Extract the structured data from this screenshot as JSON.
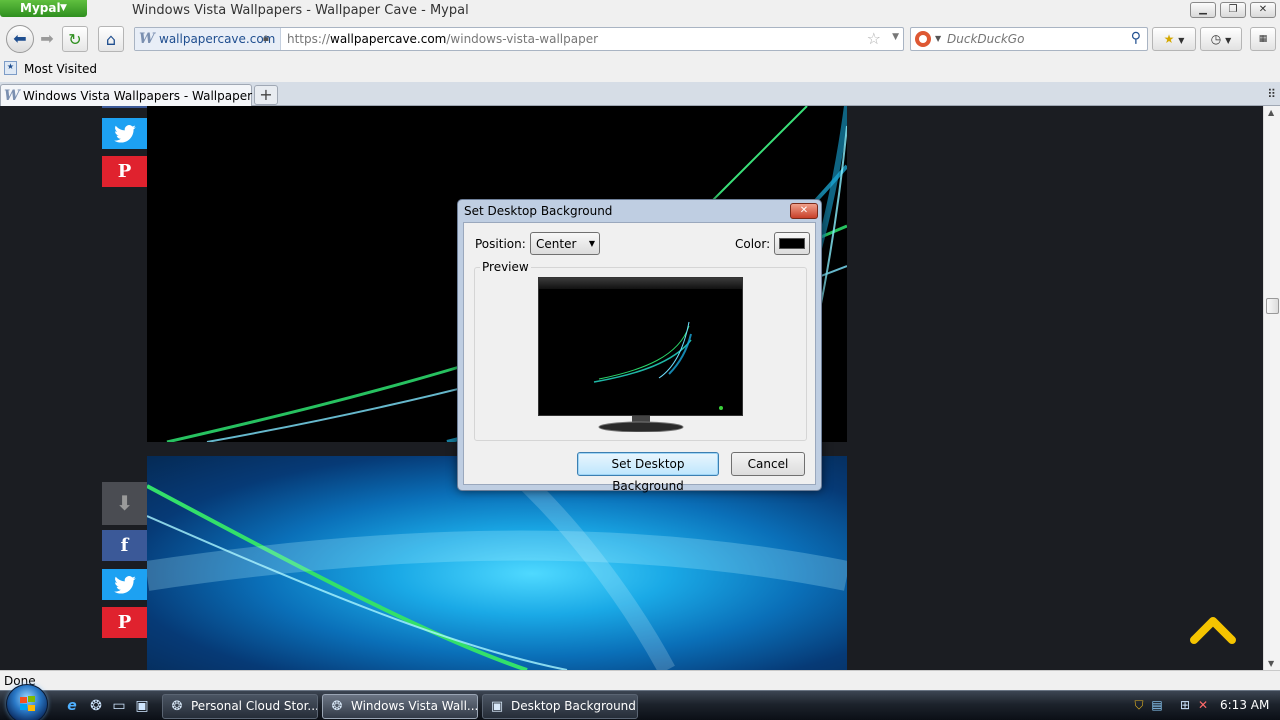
{
  "browser": {
    "app_menu_label": "Mypal",
    "window_title": "Windows Vista Wallpapers - Wallpaper Cave - Mypal",
    "site_domain": "wallpapercave.com",
    "url_scheme": "https://",
    "url_host": "wallpapercave.com",
    "url_path": "/windows-vista-wallpaper",
    "search_placeholder": "DuckDuckGo",
    "bookmark_most_visited": "Most Visited",
    "tab_title": "Windows Vista Wallpapers - Wallpaper C...",
    "status_text": "Done"
  },
  "dialog": {
    "title": "Set Desktop Background",
    "position_label": "Position:",
    "position_value": "Center",
    "color_label": "Color:",
    "color_value": "#000000",
    "preview_label": "Preview",
    "set_button_label": "Set Desktop Background",
    "cancel_button_label": "Cancel"
  },
  "taskbar": {
    "tasks": [
      {
        "label": "Personal Cloud Stor...",
        "icon": "browser-icon"
      },
      {
        "label": "Windows Vista Wall...",
        "icon": "browser-icon",
        "active": true
      },
      {
        "label": "Desktop Background",
        "icon": "display-icon"
      }
    ],
    "clock": "6:13 AM"
  },
  "colors": {
    "page_background": "#1b1d22",
    "facebook": "#3b5998",
    "twitter": "#1da1f2",
    "pinterest": "#e0222e",
    "scroll_top_arrow": "#f5c400",
    "dialog_frame": "#bfcee2"
  },
  "icons": {
    "nav": [
      "back-icon",
      "forward-icon",
      "reload-icon",
      "home-icon"
    ],
    "share": [
      "download-icon",
      "facebook-icon",
      "twitter-icon",
      "pinterest-icon"
    ]
  }
}
